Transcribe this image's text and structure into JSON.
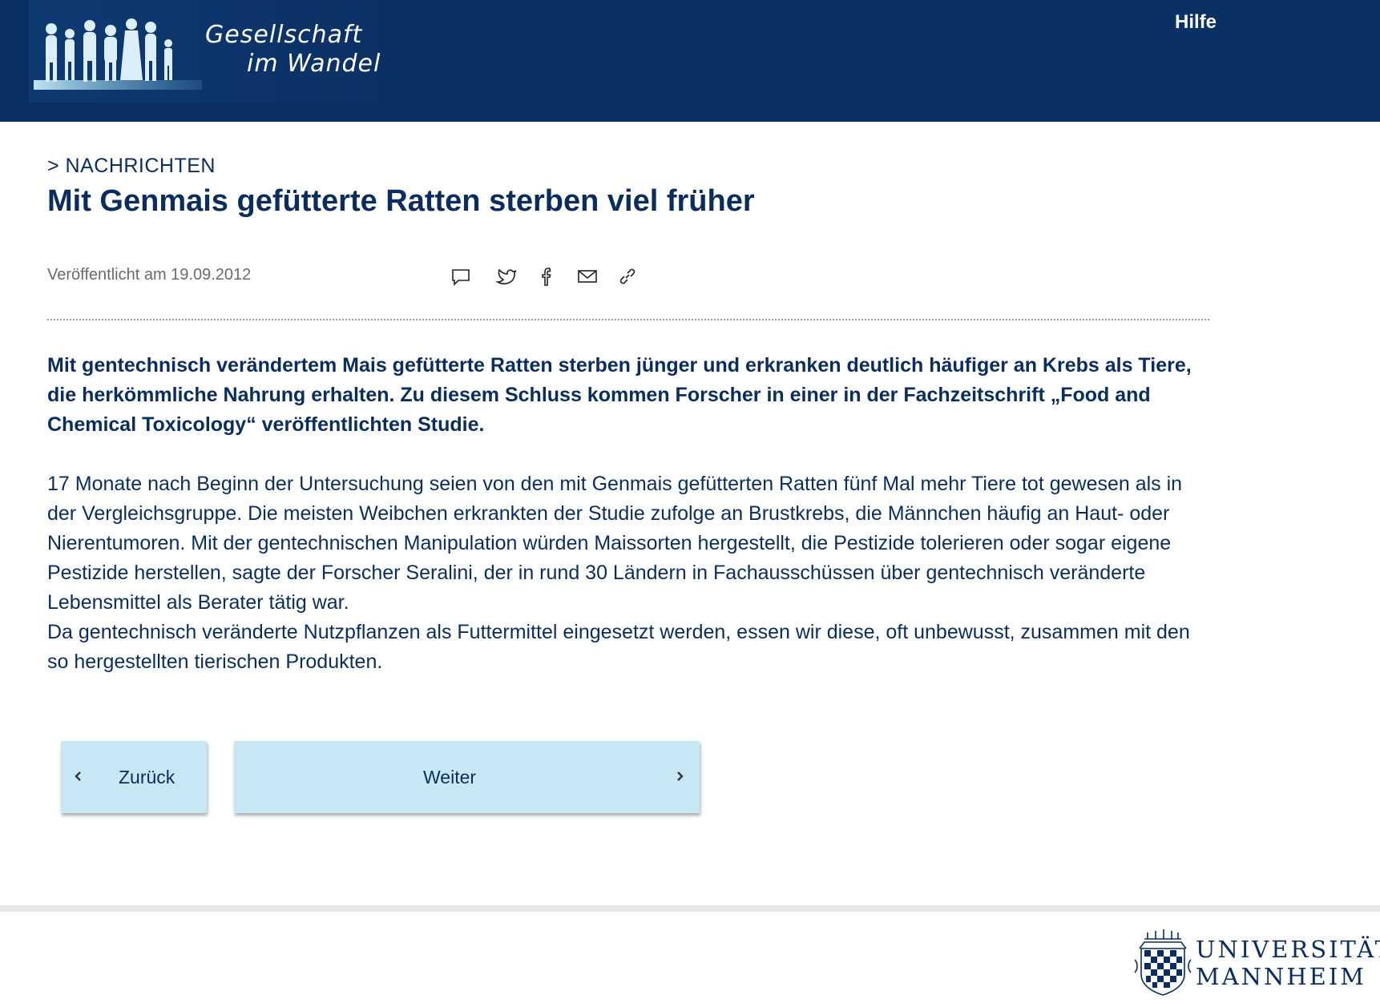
{
  "header": {
    "logo_line1": "Gesellschaft",
    "logo_line2": "im Wandel",
    "help_label": "Hilfe",
    "background_color": "#0b3064"
  },
  "article": {
    "breadcrumb": "> NACHRICHTEN",
    "title": "Mit Genmais gefütterte Ratten sterben viel früher",
    "published": "Veröffentlicht am 19.09.2012",
    "share_icons": [
      "comment-icon",
      "twitter-icon",
      "facebook-icon",
      "mail-icon",
      "link-icon"
    ],
    "lead": "Mit gentechnisch verändertem Mais gefütterte Ratten sterben jünger und erkranken deutlich häufiger an Krebs als Tiere, die herkömmliche Nahrung erhalten. Zu diesem Schluss kommen Forscher in einer in der Fachzeitschrift „Food and Chemical Toxicology“ veröffentlichten Studie.",
    "paragraph1": "17 Monate nach Beginn der Untersuchung seien von den mit Genmais gefütterten Ratten fünf Mal mehr Tiere tot gewesen als in der Vergleichsgruppe. Die meisten Weibchen erkrankten der Studie zufolge an Brustkrebs, die Männchen häufig an Haut- oder Nierentumoren. Mit der gentechnischen Manipulation würden Maissorten hergestellt, die Pestizide tolerieren oder sogar eigene Pestizide herstellen, sagte der Forscher Seralini, der in rund 30 Ländern in Fachausschüssen über gentechnisch veränderte Lebensmittel als Berater tätig war.",
    "paragraph2": "Da gentechnisch veränderte Nutzpflanzen als Futtermittel eingesetzt werden, essen wir diese, oft unbewusst, zusammen mit den so hergestellten tierischen Produkten."
  },
  "navigation": {
    "back_label": "Zurück",
    "next_label": "Weiter",
    "button_color": "#c7e7f5"
  },
  "footer": {
    "university_line1": "UNIVERSITÄT",
    "university_line2": "MANNHEIM"
  }
}
